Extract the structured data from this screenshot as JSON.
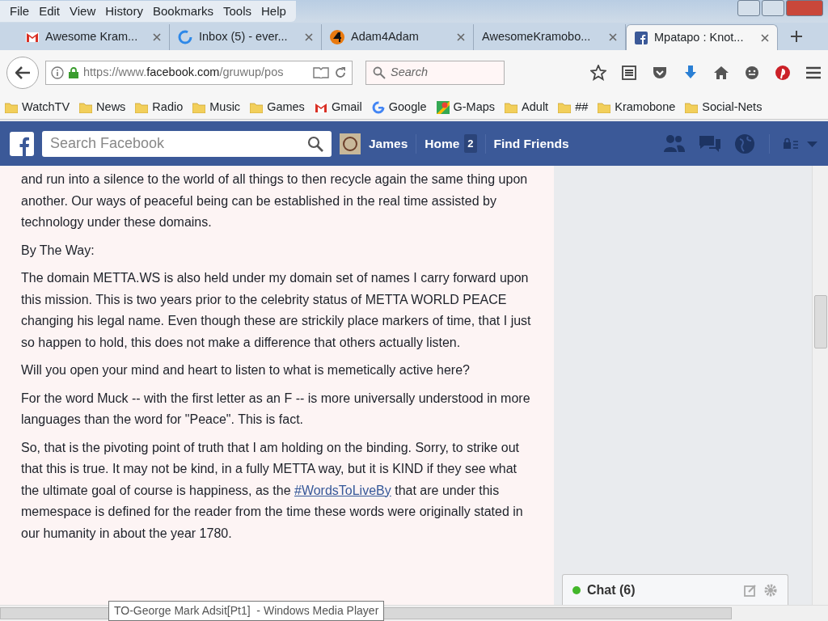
{
  "menu_bar": [
    "File",
    "Edit",
    "View",
    "History",
    "Bookmarks",
    "Tools",
    "Help"
  ],
  "tabs": [
    {
      "label": "Awesome Kram...",
      "kind": "gmail",
      "selected": false
    },
    {
      "label": "Inbox (5) - ever...",
      "kind": "ring",
      "selected": false
    },
    {
      "label": "Adam4Adam",
      "kind": "four",
      "selected": false
    },
    {
      "label": "AwesomeKramobo...",
      "kind": "plain",
      "selected": false
    },
    {
      "label": "Mpatapo : Knot...",
      "kind": "fb",
      "selected": true
    }
  ],
  "address_bar": {
    "url_start": "https://www.",
    "url_domain": "facebook.com",
    "url_end": "/gruwup/pos"
  },
  "search": {
    "placeholder": "Search"
  },
  "bookmarks": [
    {
      "label": "WatchTV",
      "kind": "folder"
    },
    {
      "label": "News",
      "kind": "folder"
    },
    {
      "label": "Radio",
      "kind": "folder"
    },
    {
      "label": "Music",
      "kind": "folder"
    },
    {
      "label": "Games",
      "kind": "folder"
    },
    {
      "label": "Gmail",
      "kind": "gmail"
    },
    {
      "label": "Google",
      "kind": "google"
    },
    {
      "label": "G-Maps",
      "kind": "maps"
    },
    {
      "label": "Adult",
      "kind": "folder"
    },
    {
      "label": "##",
      "kind": "folder"
    },
    {
      "label": "Kramobone",
      "kind": "folder"
    },
    {
      "label": "Social-Nets",
      "kind": "folder"
    }
  ],
  "facebook_bar": {
    "search_placeholder": "Search Facebook",
    "user": "James",
    "home": "Home",
    "home_count": "2",
    "find_friends": "Find Friends"
  },
  "post_paragraphs": [
    "and run into a silence to the world of all things to then recycle again the same thing upon another. Our ways of peaceful being can be established in the real time assisted by technology under these domains.",
    "By The Way:",
    "The domain METTA.WS is also held under my domain set of names I carry forward upon this mission. This is two years prior to the celebrity status of METTA WORLD PEACE changing his legal name. Even though these are strickily place markers of time, that I just so happen to hold, this does not make a difference that others actually listen.",
    "Will you open your mind and heart to listen to what is memetically active here?",
    "For the word Muck -- with the first letter as an F -- is more universally understood in more languages than the word for \"Peace\". This is fact.",
    "So, that is the pivoting point of truth that I am holding on the binding. Sorry, to strike out that this is true. It may not be kind, in a fully METTA way, but it is KIND if they see what the ultimate goal of course is happiness, as the"
  ],
  "last_paragraph_link": "#WordsToLiveBy",
  "last_paragraph_end": "that are under this memespace is defined for the reader from the time these words were originally stated in our humanity in about the year 1780.",
  "chat": {
    "label": "Chat (6)",
    "online": true
  },
  "tooltip": "TO-George Mark Adsit[Pt1]  - Windows Media Player"
}
